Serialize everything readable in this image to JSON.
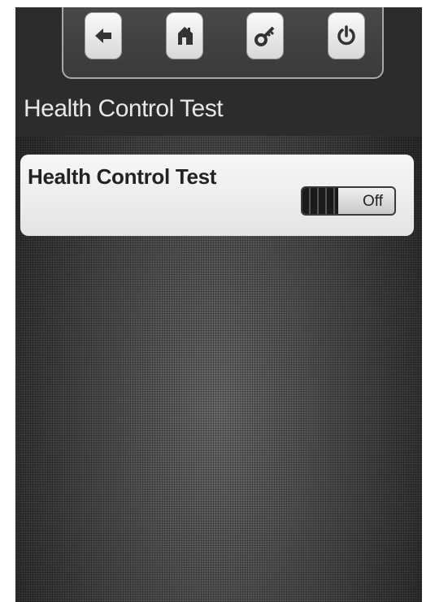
{
  "toolbar": {
    "buttons": [
      {
        "icon": "back-arrow-icon"
      },
      {
        "icon": "home-icon"
      },
      {
        "icon": "key-icon"
      },
      {
        "icon": "power-icon"
      }
    ]
  },
  "page": {
    "title": "Health Control Test"
  },
  "settings": {
    "item_label": "Health Control Test",
    "toggle_state": "Off"
  },
  "colors": {
    "background": "#3a3a3a",
    "card": "#eeeeee",
    "toggle_knob": "#1a1a1a"
  }
}
